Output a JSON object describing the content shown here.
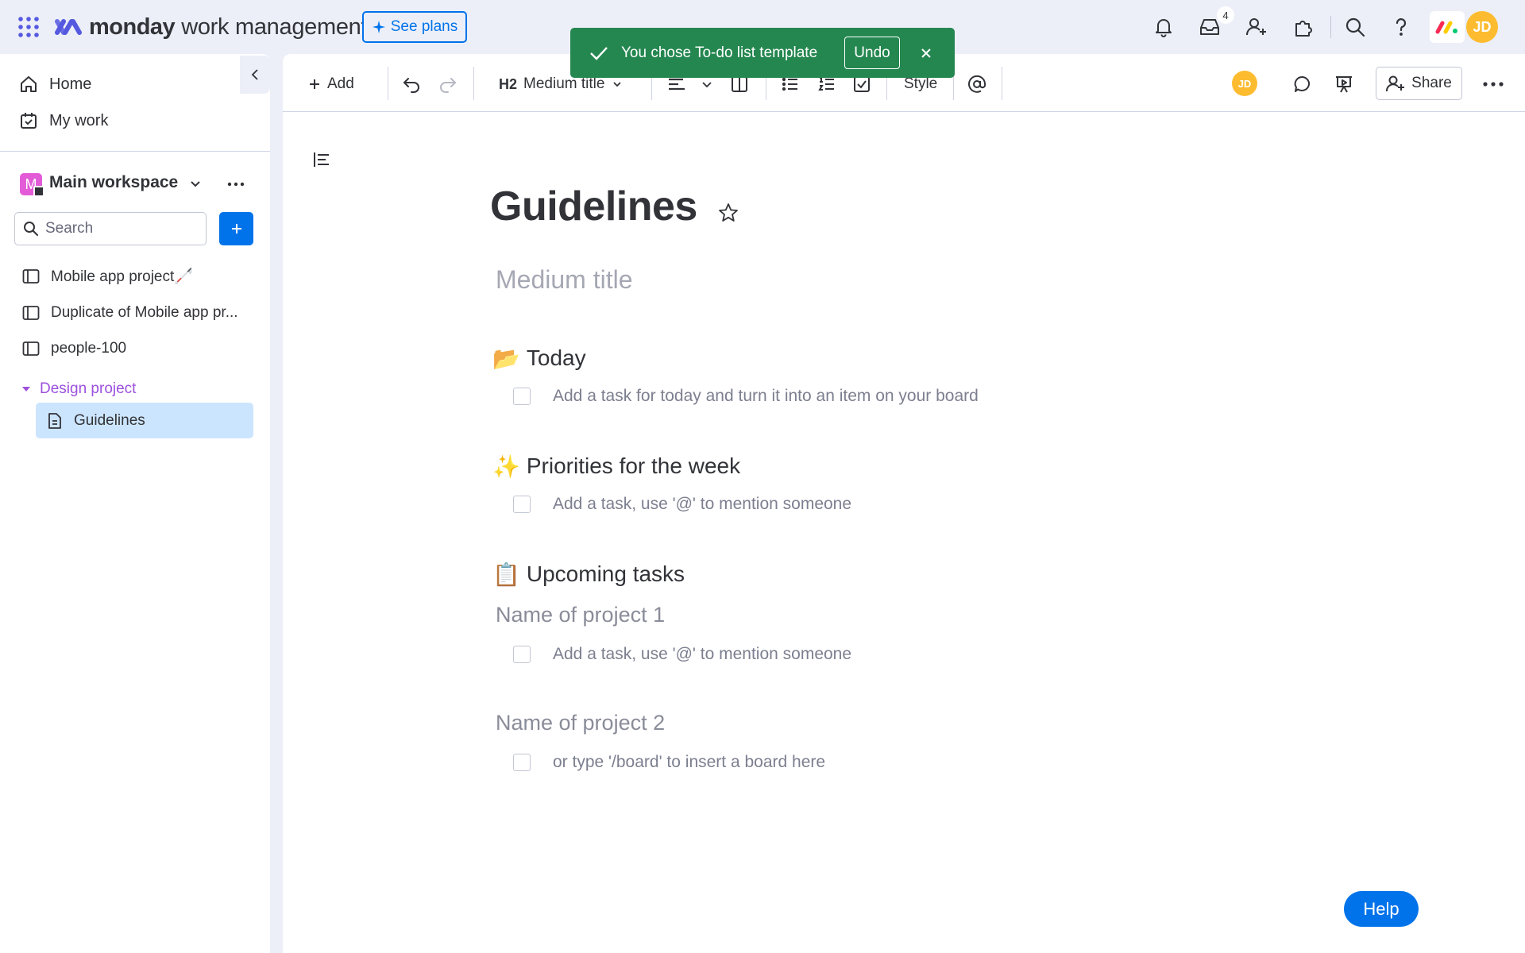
{
  "header": {
    "brand": "monday",
    "product": "work management",
    "see_plans": "See plans",
    "inbox_count": "4",
    "user_initials": "JD"
  },
  "toast": {
    "message": "You chose To-do list template",
    "undo": "Undo"
  },
  "sidebar": {
    "home": "Home",
    "my_work": "My work",
    "workspace_initial": "M",
    "workspace_name": "Main workspace",
    "search_placeholder": "Search",
    "items": [
      {
        "label": "Mobile app project🦯"
      },
      {
        "label": "Duplicate of Mobile app pr..."
      },
      {
        "label": "people-100"
      }
    ],
    "folder": "Design project",
    "selected_doc": "Guidelines"
  },
  "toolbar": {
    "add": "Add",
    "heading_tag": "H2",
    "heading_style": "Medium title",
    "style": "Style",
    "share": "Share",
    "avatar": "JD"
  },
  "doc": {
    "title": "Guidelines",
    "subtitle": "Medium title",
    "sections": [
      {
        "emoji": "📂",
        "title": "Today"
      },
      {
        "emoji": "✨",
        "title": "Priorities for the week"
      },
      {
        "emoji": "📋",
        "title": "Upcoming tasks"
      }
    ],
    "tasks": [
      "Add a task for today and turn it into an item on your board",
      "Add a task, use '@' to mention someone",
      "Add a task, use '@' to mention someone",
      "or type '/board' to insert a board here"
    ],
    "projects": [
      "Name of project 1",
      "Name of project 2"
    ]
  },
  "help": "Help",
  "colors": {
    "accent": "#0073ea",
    "toast": "#258750",
    "workspace": "#e35bd7",
    "avatar": "#fdbc2f",
    "folder": "#9d50dd",
    "selected": "#cce5ff"
  }
}
